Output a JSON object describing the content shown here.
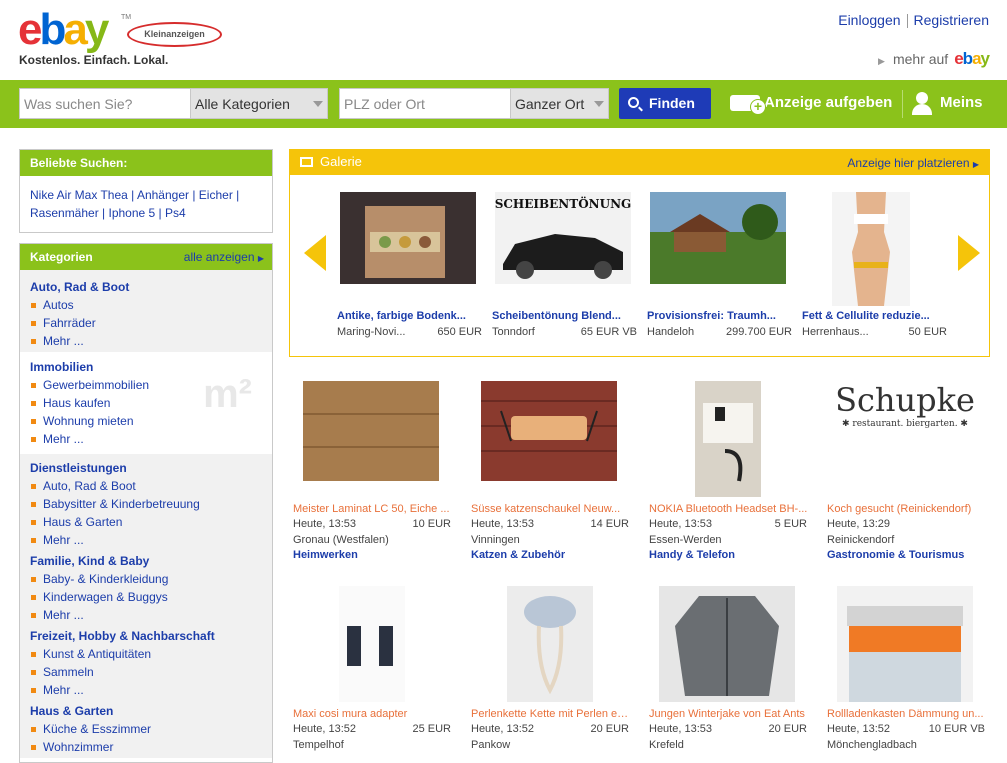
{
  "header": {
    "logo_text": "ebay",
    "logo_tm": "TM",
    "logo_badge": "Kleinanzeigen",
    "tagline": "Kostenlos. Einfach. Lokal.",
    "login": "Einloggen",
    "register": "Registrieren",
    "mehr_auf": "mehr auf",
    "mehr_auf_brand": "ebay"
  },
  "search": {
    "query_placeholder": "Was suchen Sie?",
    "category_selected": "Alle Kategorien",
    "location_placeholder": "PLZ oder Ort",
    "radius_selected": "Ganzer Ort",
    "find_label": "Finden",
    "post_ad_label": "Anzeige aufgeben",
    "account_label": "Meins"
  },
  "popular": {
    "title": "Beliebte Suchen:",
    "links": [
      "Nike Air Max Thea",
      "Anhänger",
      "Eicher",
      "Rasenmäher",
      "Iphone 5",
      "Ps4"
    ]
  },
  "categories": {
    "title": "Kategorien",
    "show_all": "alle anzeigen",
    "groups": [
      {
        "title": "Auto, Rad & Boot",
        "items": [
          "Autos",
          "Fahrräder",
          "Mehr ..."
        ]
      },
      {
        "title": "Immobilien",
        "items": [
          "Gewerbeimmobilien",
          "Haus kaufen",
          "Wohnung mieten",
          "Mehr ..."
        ],
        "watermark": "m²"
      },
      {
        "title": "Dienstleistungen",
        "items": [
          "Auto, Rad & Boot",
          "Babysitter & Kinderbetreuung",
          "Haus & Garten",
          "Mehr ..."
        ]
      },
      {
        "title": "Familie, Kind & Baby",
        "items": [
          "Baby- & Kinderkleidung",
          "Kinderwagen & Buggys",
          "Mehr ..."
        ]
      },
      {
        "title": "Freizeit, Hobby & Nachbarschaft",
        "items": [
          "Kunst & Antiquitäten",
          "Sammeln",
          "Mehr ..."
        ]
      },
      {
        "title": "Haus & Garten",
        "items": [
          "Küche & Esszimmer",
          "Wohnzimmer"
        ]
      }
    ]
  },
  "gallery": {
    "title": "Galerie",
    "place_ad": "Anzeige hier platzieren",
    "items": [
      {
        "title": "Antike, farbige Bodenk...",
        "location": "Maring-Novi...",
        "price": "650 EUR"
      },
      {
        "title": "Scheibentönung Blend...",
        "location": "Tonndorf",
        "price": "65 EUR VB",
        "image_text": "SCHEIBENTÖNUNG"
      },
      {
        "title": "Provisionsfrei: Traumh...",
        "location": "Handeloh",
        "price": "299.700 EUR"
      },
      {
        "title": "Fett & Cellulite reduzie...",
        "location": "Herrenhaus...",
        "price": "50 EUR"
      }
    ]
  },
  "listings": [
    {
      "title": "Meister Laminat LC 50, Eiche ...",
      "time": "Heute, 13:53",
      "price": "10 EUR",
      "location": "Gronau (Westfalen)",
      "category": "Heimwerken"
    },
    {
      "title": "Süsse katzenschaukel Neuw...",
      "time": "Heute, 13:53",
      "price": "14 EUR",
      "location": "Vinningen",
      "category": "Katzen & Zubehör"
    },
    {
      "title": "NOKIA Bluetooth Headset BH-...",
      "time": "Heute, 13:53",
      "price": "5 EUR",
      "location": "Essen-Werden",
      "category": "Handy & Telefon"
    },
    {
      "title": "Koch gesucht (Reinickendorf)",
      "time": "Heute, 13:29",
      "price": "",
      "location": "Reinickendorf",
      "category": "Gastronomie & Tourismus",
      "logo_name": "Schupke",
      "logo_sub": "✱ restaurant. biergarten. ✱"
    },
    {
      "title": "Maxi cosi mura adapter",
      "time": "Heute, 13:52",
      "price": "25 EUR",
      "location": "Tempelhof",
      "category": ""
    },
    {
      "title": "Perlenkette Kette mit Perlen ec...",
      "time": "Heute, 13:52",
      "price": "20 EUR",
      "location": "Pankow",
      "category": ""
    },
    {
      "title": "Jungen Winterjake von Eat Ants",
      "time": "Heute, 13:53",
      "price": "20 EUR",
      "location": "Krefeld",
      "category": ""
    },
    {
      "title": "Rollladenkasten Dämmung un...",
      "time": "Heute, 13:52",
      "price": "10 EUR VB",
      "location": "Mönchengladbach",
      "category": ""
    }
  ]
}
